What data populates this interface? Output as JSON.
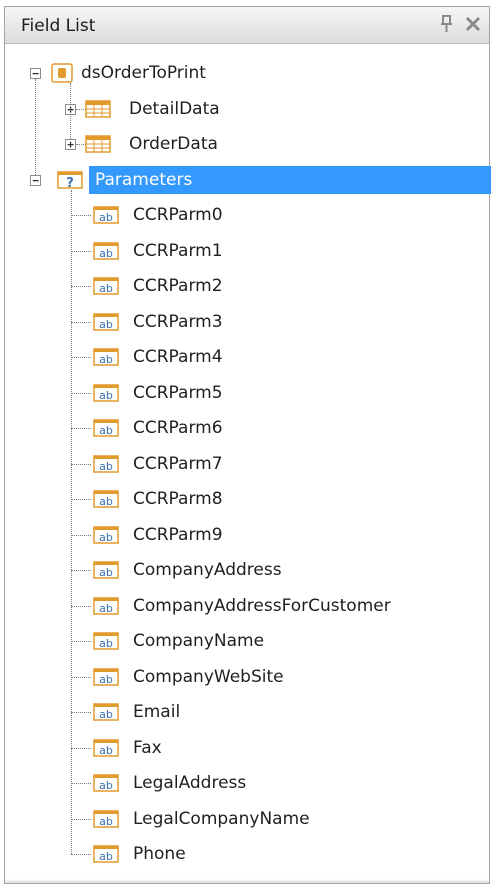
{
  "panel": {
    "title": "Field List",
    "pin_glyph": "⬙",
    "close_glyph": "✕"
  },
  "tree": {
    "root": {
      "label": "dsOrderToPrint",
      "icon": "datasource-icon",
      "expanded": true,
      "children": [
        {
          "label": "DetailData",
          "icon": "table-icon",
          "expanded": false
        },
        {
          "label": "OrderData",
          "icon": "table-icon",
          "expanded": false
        }
      ]
    },
    "parameters": {
      "label": "Parameters",
      "icon": "parameters-icon",
      "expanded": true,
      "selected": true,
      "children": [
        "CCRParm0",
        "CCRParm1",
        "CCRParm2",
        "CCRParm3",
        "CCRParm4",
        "CCRParm5",
        "CCRParm6",
        "CCRParm7",
        "CCRParm8",
        "CCRParm9",
        "CompanyAddress",
        "CompanyAddressForCustomer",
        "CompanyName",
        "CompanyWebSite",
        "Email",
        "Fax",
        "LegalAddress",
        "LegalCompanyName",
        "Phone"
      ]
    }
  },
  "colors": {
    "selection": "#3399ff",
    "icon_orange": "#e39a2c",
    "icon_blue": "#3a6fb0"
  }
}
